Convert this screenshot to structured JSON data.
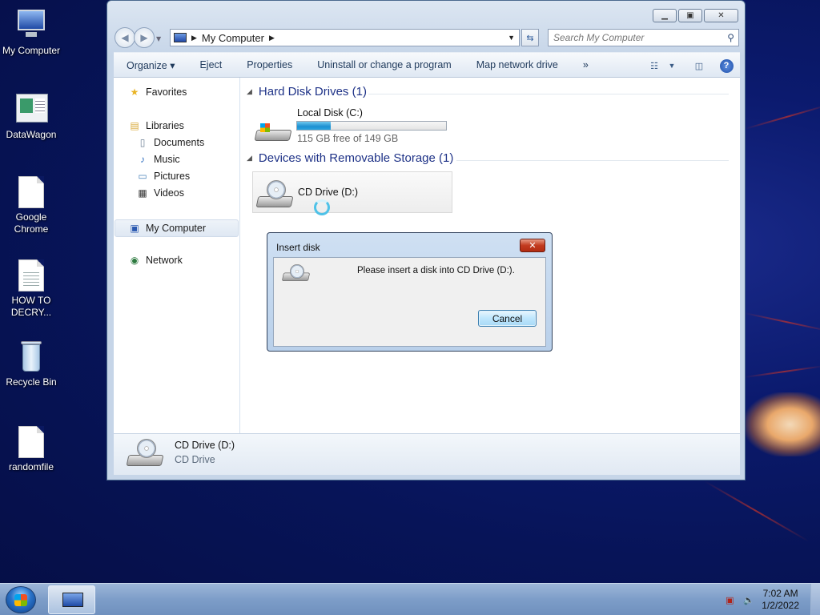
{
  "desktop": {
    "icons": [
      {
        "label": "My Computer"
      },
      {
        "label": "DataWagon"
      },
      {
        "label": "Google Chrome"
      },
      {
        "label": "HOW TO DECRY..."
      },
      {
        "label": "Recycle Bin"
      },
      {
        "label": "randomfile"
      }
    ]
  },
  "window": {
    "address": {
      "location": "My Computer"
    },
    "search": {
      "placeholder": "Search My Computer"
    },
    "toolbar": {
      "items": [
        "Organize ▾",
        "Eject",
        "Properties",
        "Uninstall or change a program",
        "Map network drive",
        "»"
      ]
    },
    "nav_pane": {
      "favorites": "Favorites",
      "libraries": "Libraries",
      "library_items": [
        "Documents",
        "Music",
        "Pictures",
        "Videos"
      ],
      "my_computer": "My Computer",
      "network": "Network"
    },
    "content": {
      "hard_disk_group": "Hard Disk Drives (1)",
      "local_disk": {
        "name": "Local Disk (C:)",
        "free_text": "115 GB free of 149 GB",
        "used_fraction": 0.228
      },
      "removable_group": "Devices with Removable Storage (1)",
      "cd_drive": {
        "name": "CD Drive (D:)"
      }
    },
    "details": {
      "name": "CD Drive (D:)",
      "type": "CD Drive"
    }
  },
  "dialog": {
    "title": "Insert disk",
    "message": "Please insert a disk into CD Drive (D:).",
    "cancel_label": "Cancel",
    "close_glyph": "✕"
  },
  "taskbar": {
    "time": "7:02 AM",
    "date": "1/2/2022"
  }
}
